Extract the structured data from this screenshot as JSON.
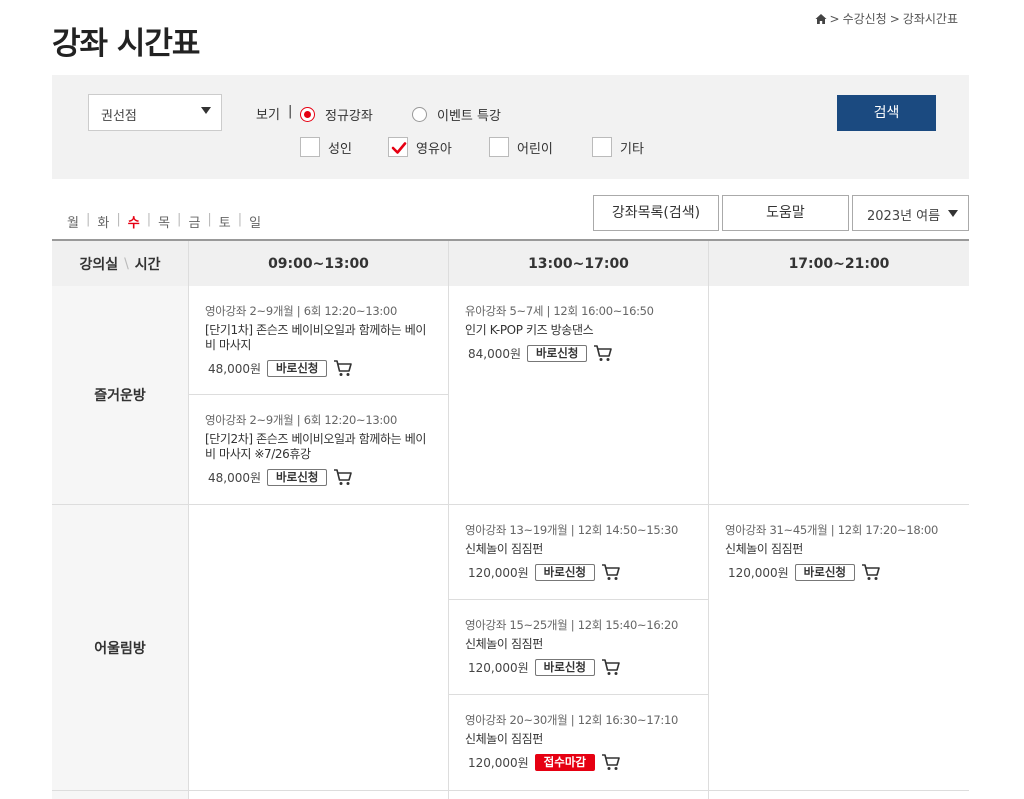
{
  "title": "강좌 시간표",
  "breadcrumb": {
    "sep1": ">",
    "item1": "수강신청",
    "sep2": ">",
    "item2": "강좌시간표"
  },
  "filter": {
    "branch": "권선점",
    "view_label": "보기",
    "view_sep": "|",
    "radio_regular": "정규강좌",
    "radio_event": "이벤트 특강",
    "check_adult": "성인",
    "check_infant": "영유아",
    "check_child": "어린이",
    "check_etc": "기타",
    "search": "검색"
  },
  "days": [
    "월",
    "화",
    "수",
    "목",
    "금",
    "토",
    "일"
  ],
  "days_sep": "|",
  "buttons": {
    "course_list": "강좌목록(검색)",
    "help": "도움말",
    "season": "2023년 여름"
  },
  "grid": {
    "corner_room": "강의실",
    "corner_sep": "\\",
    "corner_time": "시간",
    "slots": [
      "09:00~13:00",
      "13:00~17:00",
      "17:00~21:00"
    ]
  },
  "rooms": [
    {
      "name": "즐거운방",
      "slot1": [
        {
          "meta": "영아강좌 2~9개월 | 6회 12:20~13:00",
          "name": "[단기1차] 존슨즈 베이비오일과 함께하는 베이비 마사지",
          "price": "48,000원",
          "btn": "바로신청"
        },
        {
          "meta": "영아강좌 2~9개월 | 6회 12:20~13:00",
          "name": "[단기2차] 존슨즈 베이비오일과 함께하는 베이비 마사지 ※7/26휴강",
          "price": "48,000원",
          "btn": "바로신청"
        }
      ],
      "slot2": [
        {
          "meta": "유아강좌 5~7세 | 12회 16:00~16:50",
          "name": "인기 K-POP 키즈 방송댄스",
          "price": "84,000원",
          "btn": "바로신청"
        }
      ]
    },
    {
      "name": "어울림방",
      "slot2": [
        {
          "meta": "영아강좌 13~19개월 | 12회 14:50~15:30",
          "name": "신체놀이 짐짐펀",
          "price": "120,000원",
          "btn": "바로신청"
        },
        {
          "meta": "영아강좌 15~25개월 | 12회 15:40~16:20",
          "name": "신체놀이 짐짐펀",
          "price": "120,000원",
          "btn": "바로신청"
        },
        {
          "meta": "영아강좌 20~30개월 | 12회 16:30~17:10",
          "name": "신체놀이 짐짐펀",
          "price": "120,000원",
          "btn": "접수마감"
        }
      ],
      "slot3": [
        {
          "meta": "영아강좌 31~45개월 | 12회 17:20~18:00",
          "name": "신체놀이 짐짐펀",
          "price": "120,000원",
          "btn": "바로신청"
        }
      ]
    }
  ],
  "colors": {
    "accent_red": "#e60012",
    "search_blue": "#1b4a80",
    "header_gray": "#f0f0f0"
  }
}
